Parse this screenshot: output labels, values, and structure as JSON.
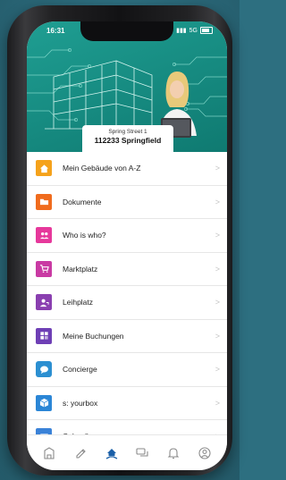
{
  "status_bar": {
    "time": "16:31",
    "carrier": "5G"
  },
  "address": {
    "street": "Spring Street 1",
    "city_line": "112233 Springfield"
  },
  "menu": [
    {
      "label": "Mein Gebäude von A-Z",
      "icon": "home-icon",
      "color": "#f5a21b"
    },
    {
      "label": "Dokumente",
      "icon": "folder-icon",
      "color": "#f06b1d"
    },
    {
      "label": "Who is who?",
      "icon": "people-icon",
      "color": "#e6389b"
    },
    {
      "label": "Marktplatz",
      "icon": "cart-icon",
      "color": "#c93aa3"
    },
    {
      "label": "Leihplatz",
      "icon": "borrow-icon",
      "color": "#8a3fb0"
    },
    {
      "label": "Meine Buchungen",
      "icon": "booking-icon",
      "color": "#6e3fb5"
    },
    {
      "label": "Concierge",
      "icon": "chat-bubble-icon",
      "color": "#2c8fd1"
    },
    {
      "label": "s: yourbox",
      "icon": "box-icon",
      "color": "#2b86d6"
    },
    {
      "label": "Calendly",
      "icon": "calendar-icon",
      "color": "#3a82d8"
    }
  ],
  "tabbar": [
    {
      "icon": "building-icon",
      "active": false
    },
    {
      "icon": "marker-icon",
      "active": false
    },
    {
      "icon": "home-hand-icon",
      "active": true
    },
    {
      "icon": "chat-icon",
      "active": false
    },
    {
      "icon": "bell-icon",
      "active": false
    },
    {
      "icon": "profile-icon",
      "active": false
    }
  ],
  "colors": {
    "header": "#168a80",
    "active_tab": "#1a5fa8",
    "inactive_tab": "#8a8a8a",
    "background": "#2d6f80"
  }
}
